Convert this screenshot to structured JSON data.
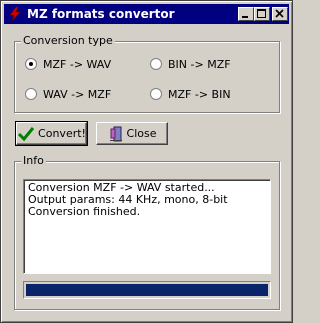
{
  "window": {
    "title": "MZ formats convertor",
    "title_bar_color": "#000080",
    "icons": {
      "app": "red-lightning-icon",
      "minimize": "minimize-icon",
      "maximize": "maximize-icon",
      "close": "close-icon"
    }
  },
  "conversion": {
    "legend": "Conversion type",
    "selected": "mzf-to-wav",
    "options": [
      {
        "id": "mzf-to-wav",
        "label": "MZF -> WAV",
        "checked": true
      },
      {
        "id": "bin-to-mzf",
        "label": "BIN -> MZF",
        "checked": false
      },
      {
        "id": "wav-to-mzf",
        "label": "WAV -> MZF",
        "checked": false
      },
      {
        "id": "mzf-to-bin",
        "label": "MZF -> BIN",
        "checked": false
      }
    ]
  },
  "buttons": {
    "convert": {
      "label": "Convert!",
      "icon": "green-checkmark-icon"
    },
    "close": {
      "label": "Close",
      "icon": "door-exit-icon"
    }
  },
  "info": {
    "legend": "Info",
    "log_lines": [
      "Conversion MZF -> WAV started...",
      "Output params: 44 KHz, mono, 8-bit",
      "Conversion finished."
    ],
    "progress_percent": 100,
    "progress_color": "#0a246a"
  }
}
